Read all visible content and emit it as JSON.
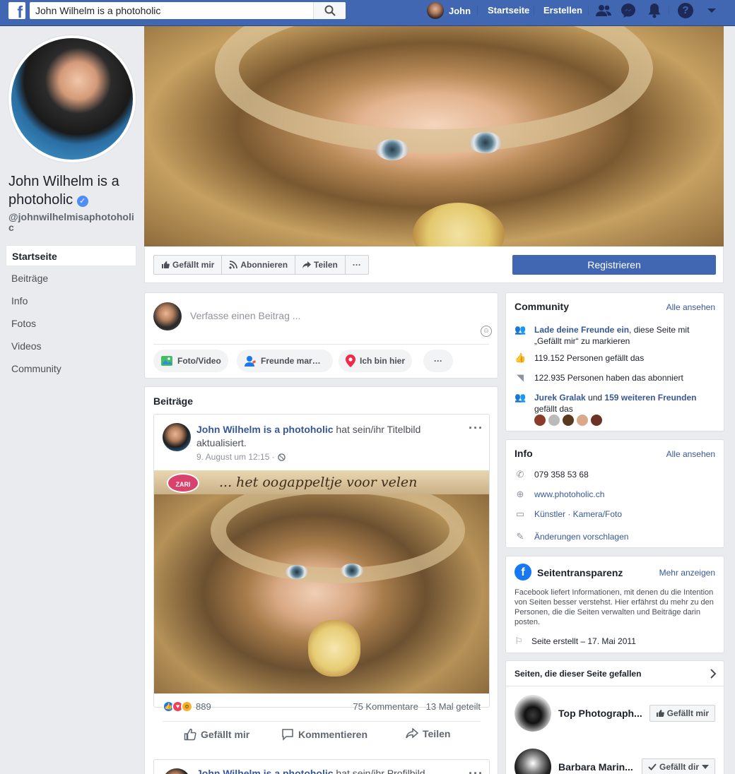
{
  "nav": {
    "logo": "f",
    "search_value": "John Wilhelm is a photoholic",
    "user_name": "John",
    "home_label": "Startseite",
    "create_label": "Erstellen",
    "help_label": "?"
  },
  "page": {
    "name": "John Wilhelm is a photoholic",
    "verified_mark": "✓",
    "handle": "@johnwilhelmisaphotoholic"
  },
  "left_nav": {
    "items": [
      {
        "label": "Startseite"
      },
      {
        "label": "Beiträge"
      },
      {
        "label": "Info"
      },
      {
        "label": "Fotos"
      },
      {
        "label": "Videos"
      },
      {
        "label": "Community"
      }
    ]
  },
  "actions": {
    "like": "Gefällt mir",
    "subscribe": "Abonnieren",
    "share": "Teilen",
    "more": "···",
    "register": "Registrieren"
  },
  "composer": {
    "placeholder": "Verfasse einen Beitrag ...",
    "photo_video": "Foto/Video",
    "tag_friends": "Freunde mar…",
    "checkin": "Ich bin hier",
    "more": "···"
  },
  "posts": {
    "header": "Beiträge",
    "post1": {
      "author": "John Wilhelm is a photoholic",
      "action": " hat sein/ihr Titelbild aktualisiert.",
      "time": "9. August um 12:15 ·",
      "banner_text": "... het oogappeltje voor velen",
      "banner_logo": "ZARI",
      "reactions_count": "889",
      "comments_shares": "75 Kommentare   13 Mal geteilt",
      "like": "Gefällt mir",
      "comment": "Kommentieren",
      "share": "Teilen"
    },
    "post2": {
      "author": "John Wilhelm is a photoholic",
      "action": " hat sein/ihr Profilbild"
    }
  },
  "community": {
    "title": "Community",
    "see_all": "Alle ansehen",
    "invite_link": "Lade deine Freunde ein",
    "invite_rest": ", diese Seite mit „Gefällt mir“ zu markieren",
    "likes": "119.152 Personen gefällt das",
    "followers": "122.935 Personen haben das abonniert",
    "friend_name": "Jurek Gralak",
    "friends_and": " und ",
    "friends_more": "159 weiteren Freunden",
    "friends_tail": " gefällt das"
  },
  "info": {
    "title": "Info",
    "see_all": "Alle ansehen",
    "phone": "079 358 53 68",
    "website": "www.photoholic.ch",
    "category": "Künstler · Kamera/Foto",
    "suggest": "Änderungen vorschlagen"
  },
  "transparency": {
    "title": "Seitentransparenz",
    "more": "Mehr anzeigen",
    "text": "Facebook liefert Informationen, mit denen du die Intention von Seiten besser verstehst. Hier erfährst du mehr zu den Personen, die die Seiten verwalten und Beiträge darin posten.",
    "created": "Seite erstellt – 17. Mai 2011"
  },
  "liked_pages": {
    "title": "Seiten, die dieser Seite gefallen",
    "items": [
      {
        "name": "Top Photograph...",
        "button": "Gefällt mir"
      },
      {
        "name": "Barbara Marin...",
        "button": "Gefällt dir"
      }
    ]
  },
  "colors": {
    "brand": "#4267b2",
    "link": "#365899",
    "background": "#e9ebee"
  }
}
